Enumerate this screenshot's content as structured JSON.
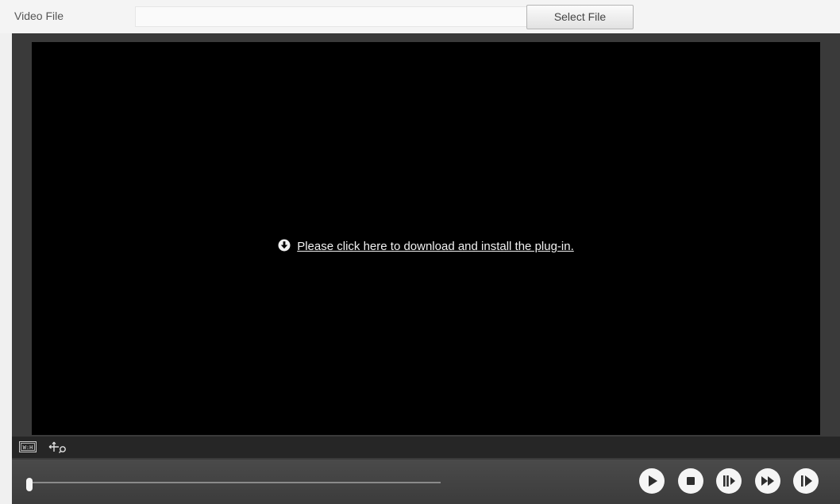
{
  "file_bar": {
    "label": "Video File",
    "path_value": "",
    "select_button_label": "Select File"
  },
  "video": {
    "plugin_message": "Please click here to download and install the plug-in."
  },
  "toolbar": {
    "icons": [
      "aspect-ratio-wh-icon",
      "digital-zoom-icon"
    ]
  },
  "playback": {
    "progress_fraction": 0.0,
    "buttons": [
      "play-icon",
      "stop-icon",
      "next-frame-icon",
      "fast-forward-icon",
      "slow-play-icon"
    ]
  },
  "colors": {
    "background": "#f0f0f0",
    "player_frame": "#3a3a3a",
    "video_bg": "#000000",
    "control_text": "#f2f2f2"
  }
}
